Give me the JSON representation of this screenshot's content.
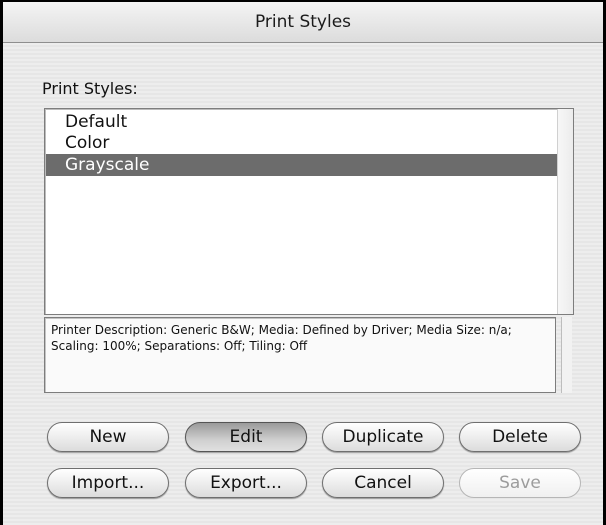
{
  "window": {
    "title": "Print Styles"
  },
  "dialog": {
    "section_label": "Print Styles:",
    "styles": [
      {
        "label": "Default",
        "selected": false
      },
      {
        "label": "Color",
        "selected": false
      },
      {
        "label": "Grayscale",
        "selected": true
      }
    ],
    "description": "Printer Description: Generic B&W;  Media: Defined by Driver;  Media Size: n/a;  Scaling: 100%;  Separations: Off;  Tiling: Off"
  },
  "buttons": {
    "new": {
      "label": "New",
      "enabled": true
    },
    "edit": {
      "label": "Edit",
      "enabled": true
    },
    "duplicate": {
      "label": "Duplicate",
      "enabled": true
    },
    "delete": {
      "label": "Delete",
      "enabled": true
    },
    "import": {
      "label": "Import...",
      "enabled": true
    },
    "export": {
      "label": "Export...",
      "enabled": true
    },
    "cancel": {
      "label": "Cancel",
      "enabled": true
    },
    "save": {
      "label": "Save",
      "enabled": false
    }
  }
}
